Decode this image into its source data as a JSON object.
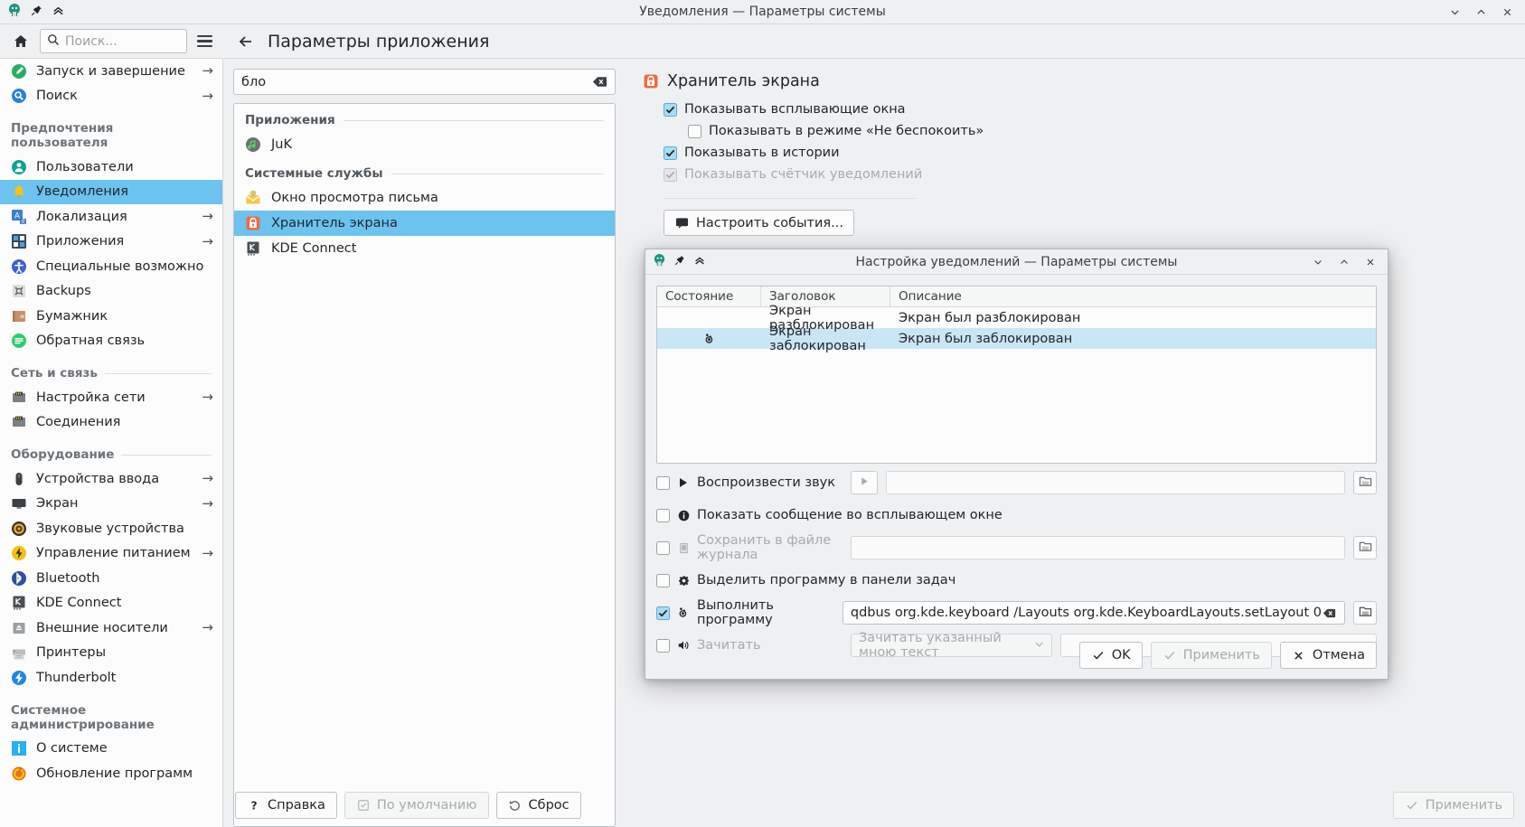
{
  "window": {
    "title": "Уведомления — Параметры системы",
    "icons": {
      "app": "kde-logo-icon",
      "pin": "pin-icon",
      "collapse": "chevron-up-icon"
    },
    "controls": {
      "minimize": "minimize-icon",
      "maximize": "maximize-icon",
      "close": "close-icon"
    }
  },
  "toolbar": {
    "home_icon": "home-icon",
    "search_placeholder": "Поиск...",
    "search_value": "",
    "search_icon": "search-icon",
    "menu_icon": "hamburger-menu-icon"
  },
  "sidebar": {
    "top_items": [
      {
        "label": "Запуск и завершение",
        "icon": "startup-icon",
        "arrow": "→"
      },
      {
        "label": "Поиск",
        "icon": "search-round-icon",
        "arrow": "→"
      }
    ],
    "groups": [
      {
        "title": "Предпочтения пользователя",
        "items": [
          {
            "label": "Пользователи",
            "icon": "users-icon",
            "arrow": ""
          },
          {
            "label": "Уведомления",
            "icon": "bell-icon",
            "arrow": "",
            "selected": true
          },
          {
            "label": "Локализация",
            "icon": "locale-icon",
            "arrow": "→"
          },
          {
            "label": "Приложения",
            "icon": "applications-icon",
            "arrow": "→"
          },
          {
            "label": "Специальные возможности",
            "icon": "accessibility-icon",
            "arrow": ""
          },
          {
            "label": "Backups",
            "icon": "backups-icon",
            "arrow": ""
          },
          {
            "label": "Бумажник",
            "icon": "wallet-icon",
            "arrow": ""
          },
          {
            "label": "Обратная связь",
            "icon": "feedback-icon",
            "arrow": ""
          }
        ]
      },
      {
        "title": "Сеть и связь",
        "items": [
          {
            "label": "Настройка сети",
            "icon": "network-icon",
            "arrow": "→"
          },
          {
            "label": "Соединения",
            "icon": "connections-icon",
            "arrow": ""
          }
        ]
      },
      {
        "title": "Оборудование",
        "items": [
          {
            "label": "Устройства ввода",
            "icon": "mouse-icon",
            "arrow": "→"
          },
          {
            "label": "Экран",
            "icon": "monitor-icon",
            "arrow": "→"
          },
          {
            "label": "Звуковые устройства",
            "icon": "audio-icon",
            "arrow": ""
          },
          {
            "label": "Управление питанием",
            "icon": "power-icon",
            "arrow": "→"
          },
          {
            "label": "Bluetooth",
            "icon": "bluetooth-icon",
            "arrow": ""
          },
          {
            "label": "KDE Connect",
            "icon": "kdeconnect-icon",
            "arrow": ""
          },
          {
            "label": "Внешние носители",
            "icon": "removable-media-icon",
            "arrow": "→"
          },
          {
            "label": "Принтеры",
            "icon": "printer-icon",
            "arrow": ""
          },
          {
            "label": "Thunderbolt",
            "icon": "thunderbolt-icon",
            "arrow": ""
          }
        ]
      },
      {
        "title": "Системное администрирование",
        "items": [
          {
            "label": "О системе",
            "icon": "info-icon",
            "arrow": ""
          },
          {
            "label": "Обновление программ",
            "icon": "update-icon",
            "arrow": ""
          }
        ]
      }
    ]
  },
  "main": {
    "back_icon": "back-arrow-icon",
    "title": "Параметры приложения",
    "filter": {
      "value": "бло",
      "clear_icon": "clear-text-icon"
    },
    "app_list": [
      {
        "group": "Приложения",
        "items": [
          {
            "label": "JuK",
            "icon": "juk-icon",
            "selected": false
          }
        ]
      },
      {
        "group": "Системные службы",
        "items": [
          {
            "label": "Окно просмотра письма",
            "icon": "mail-icon",
            "selected": false
          },
          {
            "label": "Хранитель экрана",
            "icon": "lock-icon",
            "selected": true
          },
          {
            "label": "KDE Connect",
            "icon": "kdeconnect-icon",
            "selected": false
          }
        ]
      }
    ],
    "detail": {
      "title": "Хранитель экрана",
      "title_icon": "lock-icon",
      "options": [
        {
          "label": "Показывать всплывающие окна",
          "checked": true,
          "disabled": false,
          "indent": false
        },
        {
          "label": "Показывать в режиме «Не беспокоить»",
          "checked": false,
          "disabled": false,
          "indent": true
        },
        {
          "label": "Показывать в истории",
          "checked": true,
          "disabled": false,
          "indent": false
        },
        {
          "label": "Показывать счётчик уведомлений",
          "checked": true,
          "disabled": true,
          "indent": false
        }
      ],
      "events_button": {
        "label": "Настроить события...",
        "icon": "events-icon"
      }
    }
  },
  "bottombar": {
    "help": {
      "label": "Справка",
      "icon": "help-icon"
    },
    "defaults": {
      "label": "По умолчанию",
      "icon": "defaults-icon",
      "disabled": true
    },
    "reset": {
      "label": "Сброс",
      "icon": "reset-icon",
      "disabled": false
    },
    "apply": {
      "label": "Применить",
      "icon": "check-icon",
      "disabled": true
    }
  },
  "dialog": {
    "title": "Настройка уведомлений — Параметры системы",
    "icons": {
      "app": "kde-logo-icon",
      "pin": "pin-icon",
      "collapse": "chevron-up-icon"
    },
    "controls": {
      "minimize": "minimize-icon",
      "maximize": "maximize-icon",
      "close": "close-icon"
    },
    "table": {
      "columns": [
        "Состояние",
        "Заголовок",
        "Описание"
      ],
      "rows": [
        {
          "state_icon": "",
          "title": "Экран разблокирован",
          "description": "Экран был разблокирован",
          "selected": false
        },
        {
          "state_icon": "run-program-icon",
          "title": "Экран заблокирован",
          "description": "Экран был заблокирован",
          "selected": true
        }
      ]
    },
    "actions": [
      {
        "label": "Воспроизвести звук",
        "icon": "play-icon",
        "checked": false,
        "disabled": false,
        "has_play_button": true,
        "play_icon": "play-button-icon",
        "field_value": "",
        "has_field": true,
        "field_disabled": true,
        "has_browse": true,
        "browse_icon": "folder-icon"
      },
      {
        "label": "Показать сообщение во всплывающем окне",
        "icon": "info-circle-icon",
        "checked": false,
        "disabled": false,
        "has_field": false
      },
      {
        "label": "Сохранить в файле журнала",
        "icon": "log-file-icon",
        "checked": false,
        "disabled": true,
        "has_field": true,
        "field_value": "",
        "field_disabled": true,
        "has_browse": true,
        "browse_icon": "folder-icon"
      },
      {
        "label": "Выделить программу в панели задач",
        "icon": "gear-icon",
        "checked": false,
        "disabled": false,
        "has_field": false
      },
      {
        "label": "Выполнить программу",
        "icon": "run-program-icon",
        "checked": true,
        "disabled": false,
        "has_field": true,
        "field_value": "qdbus org.kde.keyboard /Layouts org.kde.KeyboardLayouts.setLayout 0",
        "field_disabled": false,
        "has_clear": true,
        "clear_icon": "clear-text-icon",
        "has_browse": true,
        "browse_icon": "folder-icon"
      },
      {
        "label": "Зачитать",
        "icon": "speaker-icon",
        "checked": false,
        "disabled": true,
        "has_combo": true,
        "combo_value": "Зачитать указанный мною текст",
        "combo_caret": "chevron-down-icon",
        "has_field": true,
        "field_value": "",
        "field_disabled": true
      }
    ],
    "buttons": {
      "ok": {
        "label": "OK",
        "icon": "check-icon",
        "disabled": false
      },
      "apply": {
        "label": "Применить",
        "icon": "check-icon",
        "disabled": true
      },
      "cancel": {
        "label": "Отмена",
        "icon": "cross-icon",
        "disabled": false
      }
    }
  },
  "colors": {
    "selection": "#6cc3ef",
    "row_selection": "#c9e6f7",
    "window_bg": "#eff0f1",
    "view_bg": "#fcfcfc",
    "accent_lock": "#ef6b44"
  }
}
